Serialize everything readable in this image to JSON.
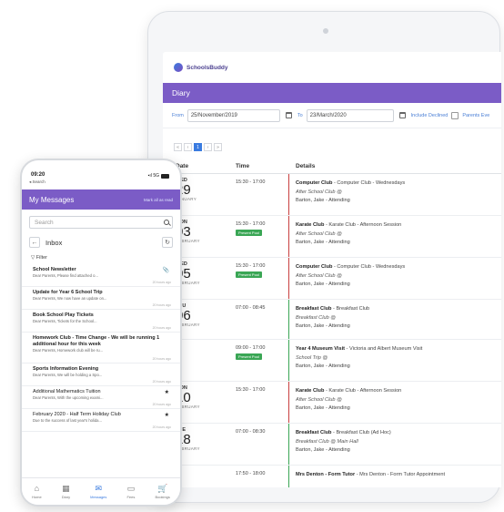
{
  "tablet": {
    "brand": "SchoolsBuddy",
    "section_title": "Diary",
    "filters": {
      "from_label": "From",
      "from_value": "25/November/2019",
      "to_label": "To",
      "to_value": "23/March/2020",
      "include_declined": "Include Declined",
      "parents_evening": "Parents Eve"
    },
    "pager": [
      "«",
      "‹",
      "1",
      "›",
      "»"
    ],
    "columns": {
      "date": "Date",
      "time": "Time",
      "details": "Details"
    },
    "rows": [
      {
        "dow": "WED",
        "day": "29",
        "month": "JANUARY",
        "time": "15:30 - 17:00",
        "badge": "",
        "title": "Computer Club",
        "sub": " - Computer Club - Wednesdays",
        "loc": "After School Club @",
        "who": "Barton, Jake - Attending",
        "bar": "#c94040"
      },
      {
        "dow": "MON",
        "day": "03",
        "month": "FEBRUARY",
        "time": "15:30 - 17:00",
        "badge": "Present Pool",
        "title": "Karate Club",
        "sub": " - Karate Club - Afternoon Session",
        "loc": "After School Club @",
        "who": "Barton, Jake - Attending",
        "bar": "#c94040"
      },
      {
        "dow": "WED",
        "day": "05",
        "month": "FEBRUARY",
        "time": "15:30 - 17:00",
        "badge": "Present Pool",
        "title": "Computer Club",
        "sub": " - Computer Club - Wednesdays",
        "loc": "After School Club @",
        "who": "Barton, Jake - Attending",
        "bar": "#c94040"
      },
      {
        "dow": "THU",
        "day": "06",
        "month": "FEBRUARY",
        "time": "07:00 - 08:45",
        "badge": "",
        "title": "Breakfast Club",
        "sub": " - Breakfast Club",
        "loc": "Breakfast Club @",
        "who": "Barton, Jake - Attending",
        "bar": "#3aa655"
      },
      {
        "dow": "",
        "day": "",
        "month": "",
        "time": "09:00 - 17:00",
        "badge": "Present Pool",
        "title": "Year 4 Museum Visit",
        "sub": " - Victoria and Albert Museum Visit",
        "loc": "School Trip @",
        "who": "Barton, Jake - Attending",
        "bar": "#3aa655"
      },
      {
        "dow": "MON",
        "day": "10",
        "month": "FEBRUARY",
        "time": "15:30 - 17:00",
        "badge": "",
        "title": "Karate Club",
        "sub": " - Karate Club - Afternoon Session",
        "loc": "After School Club @",
        "who": "Barton, Jake - Attending",
        "bar": "#c94040"
      },
      {
        "dow": "TUE",
        "day": "18",
        "month": "FEBRUARY",
        "time": "07:00 - 08:30",
        "badge": "",
        "title": "Breakfast Club",
        "sub": " - Breakfast Club (Ad Hoc)",
        "loc": "Breakfast Club @ Main Hall",
        "who": "Barton, Jake - Attending",
        "bar": "#3aa655"
      },
      {
        "dow": "",
        "day": "",
        "month": "",
        "time": "17:50 - 18:00",
        "badge": "",
        "title": "Mrs Denton - Form Tutor",
        "sub": " - Mrs Denton - Form Tutor Appointment",
        "loc": "",
        "who": "",
        "bar": "#3aa655"
      }
    ]
  },
  "phone": {
    "time": "09:20",
    "back_app": "◂ Search",
    "signal": "▪ıl 5G",
    "header_title": "My Messages",
    "mark_all_read": "Mark all as read",
    "search_placeholder": "Search",
    "folder": "Inbox",
    "filter_label": "Filter",
    "messages": [
      {
        "title": "School Newsletter",
        "preview": "Dear Parents,  Please find attached o...",
        "ago": "20 hours ago",
        "bold": true,
        "flag": "📎",
        "tall": false
      },
      {
        "title": "Update for Year 6 School Trip",
        "preview": "Dear Parents,  We now have an update on...",
        "ago": "20 hours ago",
        "bold": true,
        "flag": "",
        "tall": false
      },
      {
        "title": "Book School Play Tickets",
        "preview": "Dear Parents,  Tickets for the School...",
        "ago": "20 hours ago",
        "bold": true,
        "flag": "",
        "tall": false
      },
      {
        "title": "Homework Club - Time Change - We will be running 1 additional hour for this week",
        "preview": "Dear Parents,  Homework club will be ru...",
        "ago": "20 hours ago",
        "bold": true,
        "flag": "",
        "tall": true
      },
      {
        "title": "Sports Information Evening",
        "preview": "Dear Parents,  We will be holding a Spo...",
        "ago": "20 hours ago",
        "bold": true,
        "flag": "",
        "tall": false
      },
      {
        "title": "Additional Mathematics Tuition",
        "preview": "Dear Parents,  With the upcoming exami...",
        "ago": "20 hours ago",
        "bold": false,
        "flag": "★",
        "tall": false
      },
      {
        "title": "February 2020 - Half Term Holiday Club",
        "preview": "Due to the success of last year's holida...",
        "ago": "20 hours ago",
        "bold": false,
        "flag": "★",
        "tall": false
      }
    ],
    "tabs": [
      {
        "label": "Home",
        "icon": "⌂",
        "active": false
      },
      {
        "label": "Diary",
        "icon": "▦",
        "active": false
      },
      {
        "label": "Messages",
        "icon": "✉",
        "active": true
      },
      {
        "label": "Fees",
        "icon": "▭",
        "active": false
      },
      {
        "label": "Bookings",
        "icon": "🛒",
        "active": false
      }
    ]
  },
  "colors": {
    "accent": "#7b5cc6",
    "link": "#3a7be0",
    "present": "#3aa655",
    "late": "#c94040"
  }
}
